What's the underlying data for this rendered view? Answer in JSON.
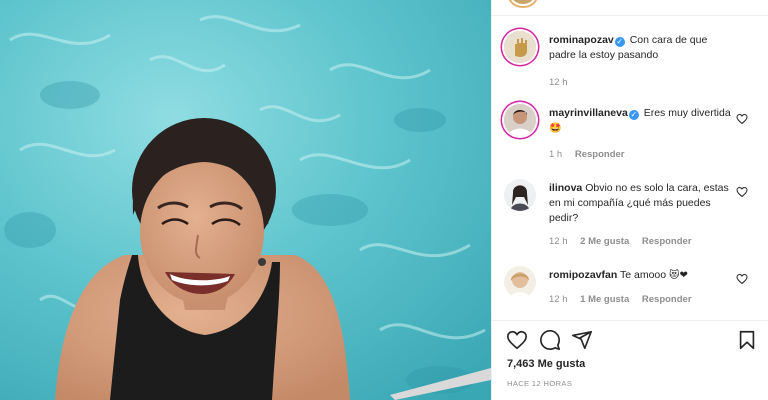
{
  "post": {
    "caption": {
      "username": "rominapozav",
      "verified": true,
      "text": "Con cara de que padre la estoy pasando",
      "time": "12 h"
    }
  },
  "comments": [
    {
      "username": "mayrinvillaneva",
      "verified": true,
      "text": "Eres muy divertida",
      "emoji": "🤩",
      "time": "1 h",
      "likes": "",
      "reply_label": "Responder"
    },
    {
      "username": "ilinova",
      "verified": false,
      "text": "Obvio no es solo la cara, estas en mi compañía ¿qué más puedes pedir?",
      "emoji": "",
      "time": "12 h",
      "likes": "2 Me gusta",
      "reply_label": "Responder"
    },
    {
      "username": "romipozavfan",
      "verified": false,
      "text": "Te amooo",
      "emoji": "😻❤",
      "time": "12 h",
      "likes": "1 Me gusta",
      "reply_label": "Responder"
    }
  ],
  "actions": {
    "icons": [
      "heart-icon",
      "comment-icon",
      "share-icon",
      "bookmark-icon"
    ]
  },
  "stats": {
    "likes_text": "7,463 Me gusta",
    "time_ago": "HACE 12 HORAS"
  },
  "colors": {
    "verified": "#3897f0",
    "story_ring": "#d6249f",
    "secondary_text": "#8e8e8e",
    "water": "#5fc3cb"
  }
}
